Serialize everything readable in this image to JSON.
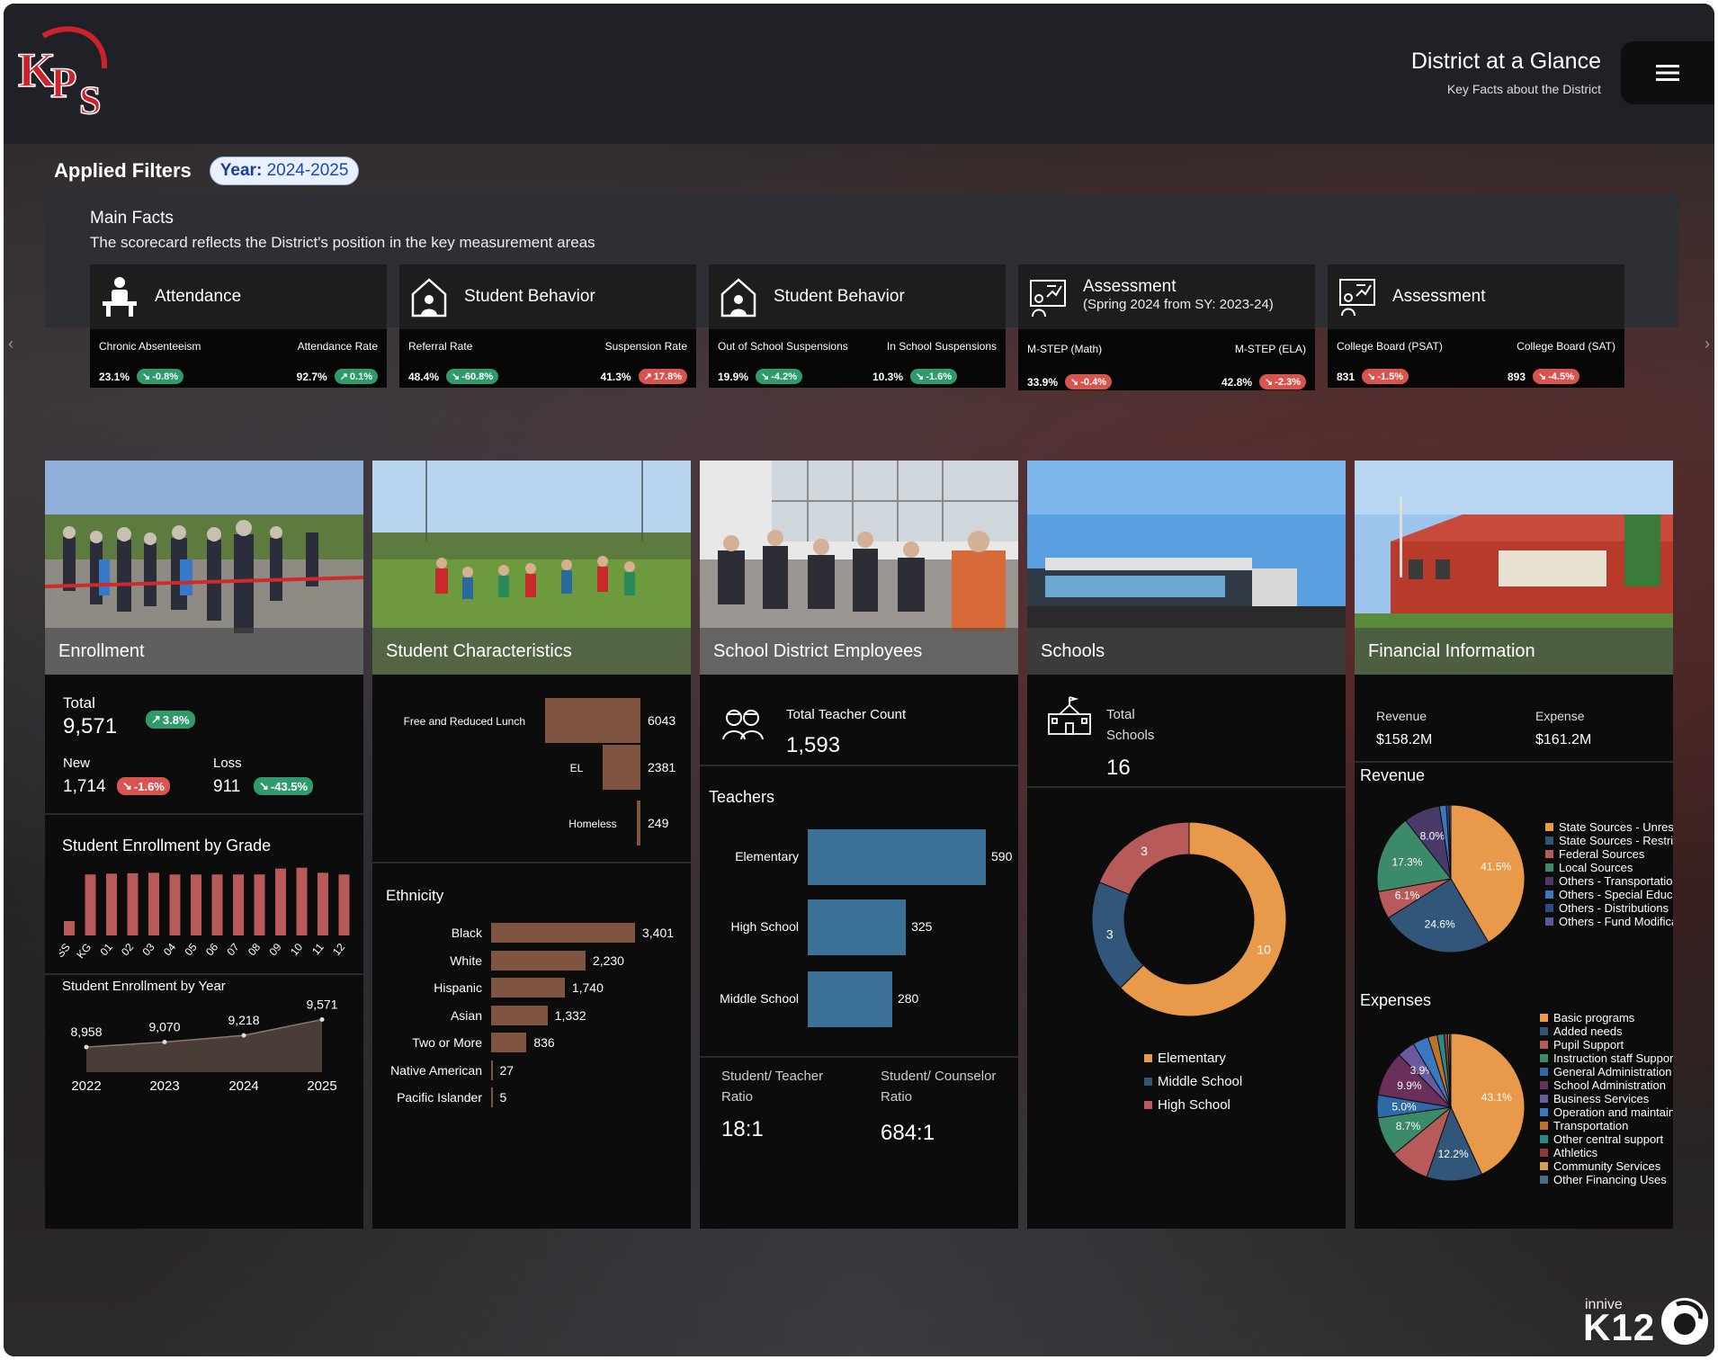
{
  "header": {
    "logo_text": "KPS",
    "title": "District at a Glance",
    "subtitle": "Key Facts about the District"
  },
  "filters": {
    "label": "Applied Filters",
    "chip_key": "Year:",
    "chip_value": "2024-2025"
  },
  "main_facts": {
    "title": "Main Facts",
    "subtitle": "The scorecard reflects the District's position in the key measurement areas"
  },
  "kpis": [
    {
      "title": "Attendance",
      "subtitle": "",
      "icon": "student-desk-icon",
      "m1": "Chronic Absenteeism",
      "v1": "23.1%",
      "d1": "-0.8%",
      "d1c": "green",
      "m2": "Attendance Rate",
      "v2": "92.7%",
      "d2": "0.1%",
      "d2c": "green"
    },
    {
      "title": "Student Behavior",
      "subtitle": "",
      "icon": "school-house-icon",
      "m1": "Referral Rate",
      "v1": "48.4%",
      "d1": "-60.8%",
      "d1c": "green",
      "m2": "Suspension Rate",
      "v2": "41.3%",
      "d2": "17.8%",
      "d2c": "red"
    },
    {
      "title": "Student Behavior",
      "subtitle": "",
      "icon": "school-house-icon",
      "m1": "Out of School Suspensions",
      "v1": "19.9%",
      "d1": "-4.2%",
      "d1c": "green",
      "m2": "In School Suspensions",
      "v2": "10.3%",
      "d2": "-1.6%",
      "d2c": "green"
    },
    {
      "title": "Assessment",
      "subtitle": "(Spring 2024 from SY: 2023-24)",
      "icon": "presentation-icon",
      "m1": "M-STEP (Math)",
      "v1": "33.9%",
      "d1": "-0.4%",
      "d1c": "red",
      "m2": "M-STEP (ELA)",
      "v2": "42.8%",
      "d2": "-2.3%",
      "d2c": "red"
    },
    {
      "title": "Assessment",
      "subtitle": "",
      "icon": "presentation-icon",
      "m1": "College Board (PSAT)",
      "v1": "831",
      "d1": "-1.5%",
      "d1c": "red",
      "m2": "College Board (SAT)",
      "v2": "893",
      "d2": "-4.5%",
      "d2c": "red"
    }
  ],
  "enrollment": {
    "caption": "Enrollment",
    "total_label": "Total",
    "total": "9,571",
    "total_delta": "3.8%",
    "new_label": "New",
    "new": "1,714",
    "new_delta": "-1.6%",
    "loss_label": "Loss",
    "loss": "911",
    "loss_delta": "-43.5%",
    "grade_title": "Student Enrollment by Grade",
    "year_title": "Student Enrollment by Year"
  },
  "characteristics": {
    "caption": "Student Characteristics",
    "ethnicity_title": "Ethnicity"
  },
  "employees": {
    "caption": "School District Employees",
    "teacher_count_label": "Total Teacher Count",
    "teacher_count": "1,593",
    "teachers_title": "Teachers",
    "st_ratio_label1": "Student/ Teacher",
    "st_ratio_label2": "Ratio",
    "st_ratio": "18:1",
    "sc_ratio_label1": "Student/ Counselor",
    "sc_ratio_label2": "Ratio",
    "sc_ratio": "684:1"
  },
  "schools": {
    "caption": "Schools",
    "total_label1": "Total",
    "total_label2": "Schools",
    "total": "16"
  },
  "financial": {
    "caption": "Financial Information",
    "revenue_label": "Revenue",
    "revenue": "$158.2M",
    "expense_label": "Expense",
    "expense": "$161.2M",
    "revenue_title": "Revenue",
    "expenses_title": "Expenses"
  },
  "brand": {
    "small": "innive",
    "big": "K12"
  },
  "colors": {
    "accent_orange": "#e8994a",
    "accent_blue": "#31567a",
    "accent_red": "#b95a5a",
    "bar_brown": "#7f5440",
    "bar_blue": "#3c7198",
    "green": "#2f9a6a",
    "red": "#d9534f"
  },
  "chart_data": [
    {
      "type": "bar",
      "id": "grade",
      "title": "Student Enrollment by Grade",
      "categories": [
        "YSS",
        "KG",
        "01",
        "02",
        "03",
        "04",
        "05",
        "06",
        "07",
        "08",
        "09",
        "10",
        "11",
        "12"
      ],
      "values": [
        170,
        720,
        730,
        735,
        740,
        720,
        720,
        720,
        720,
        720,
        790,
        800,
        740,
        720
      ]
    },
    {
      "type": "area",
      "id": "year",
      "title": "Student Enrollment by Year",
      "categories": [
        "2022",
        "2023",
        "2024",
        "2025"
      ],
      "values": [
        8958,
        9070,
        9218,
        9571
      ],
      "labels": [
        "8,958",
        "9,070",
        "9,218",
        "9,571"
      ]
    },
    {
      "type": "bar",
      "id": "chars",
      "categories": [
        "Free and Reduced Lunch",
        "EL",
        "Homeless"
      ],
      "values": [
        6043,
        2381,
        249
      ]
    },
    {
      "type": "bar",
      "id": "ethnicity",
      "title": "Ethnicity",
      "categories": [
        "Black",
        "White",
        "Hispanic",
        "Asian",
        "Two or More",
        "Native American",
        "Pacific Islander"
      ],
      "values": [
        3401,
        2230,
        1740,
        1332,
        836,
        27,
        5
      ],
      "labels": [
        "3,401",
        "2,230",
        "1,740",
        "1,332",
        "836",
        "27",
        "5"
      ]
    },
    {
      "type": "bar",
      "id": "teachers",
      "title": "Teachers",
      "categories": [
        "Elementary",
        "High School",
        "Middle School"
      ],
      "values": [
        590,
        325,
        280
      ]
    },
    {
      "type": "pie",
      "id": "schools",
      "series": [
        {
          "name": "Elementary",
          "value": 10,
          "color": "#e8994a"
        },
        {
          "name": "Middle School",
          "value": 3,
          "color": "#31567a"
        },
        {
          "name": "High School",
          "value": 3,
          "color": "#b95a5a"
        }
      ]
    },
    {
      "type": "pie",
      "id": "revenue",
      "title": "Revenue",
      "slices": [
        {
          "name": "State Sources - Unrestr...",
          "value": 41.5,
          "label": "41.5%",
          "color": "#e8994a"
        },
        {
          "name": "State Sources - Restric...",
          "value": 24.6,
          "label": "24.6%",
          "color": "#31567a"
        },
        {
          "name": "Federal Sources",
          "value": 6.1,
          "label": "6.1%",
          "color": "#b95a5a"
        },
        {
          "name": "Local Sources",
          "value": 17.3,
          "label": "17.3%",
          "color": "#3b8a6a"
        },
        {
          "name": "Others - Transportation",
          "value": 8.0,
          "label": "8.0%",
          "color": "#4a3a6a"
        },
        {
          "name": "Others - Special Educat...",
          "value": 1.5,
          "label": "",
          "color": "#3a78c0"
        },
        {
          "name": "Others - Distributions",
          "value": 0.6,
          "label": "",
          "color": "#2a4a8a"
        },
        {
          "name": "Others - Fund Modifica...",
          "value": 0.4,
          "label": "",
          "color": "#5a5a9a"
        }
      ]
    },
    {
      "type": "pie",
      "id": "expenses",
      "title": "Expenses",
      "slices": [
        {
          "name": "Basic programs",
          "value": 43.1,
          "label": "43.1%",
          "color": "#e8994a"
        },
        {
          "name": "Added needs",
          "value": 12.2,
          "label": "12.2%",
          "color": "#31567a"
        },
        {
          "name": "Pupil Support",
          "value": 8.7,
          "label": "",
          "color": "#b95a5a"
        },
        {
          "name": "Instruction staff Support",
          "value": 8.7,
          "label": "8.7%",
          "color": "#3b8a6a"
        },
        {
          "name": "General Administration",
          "value": 5.0,
          "label": "5.0%",
          "color": "#2e6aa8"
        },
        {
          "name": "School Administration",
          "value": 9.9,
          "label": "9.9%",
          "color": "#6a2f5a"
        },
        {
          "name": "Business Services",
          "value": 3.9,
          "label": "3.9%",
          "color": "#6a5aa0"
        },
        {
          "name": "Operation and maintain...",
          "value": 3.5,
          "label": "",
          "color": "#3a78c0"
        },
        {
          "name": "Transportation",
          "value": 2.0,
          "label": "",
          "color": "#c0722a"
        },
        {
          "name": "Other central support",
          "value": 1.5,
          "label": "",
          "color": "#2a8a8a"
        },
        {
          "name": "Athletics",
          "value": 0.8,
          "label": "",
          "color": "#8a3a3a"
        },
        {
          "name": "Community Services",
          "value": 0.4,
          "label": "",
          "color": "#d4a050"
        },
        {
          "name": "Other Financing Uses",
          "value": 0.3,
          "label": "",
          "color": "#4a6a8a"
        }
      ]
    }
  ]
}
